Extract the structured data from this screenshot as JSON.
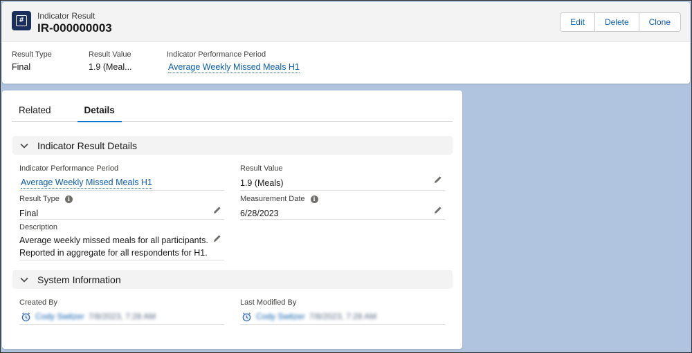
{
  "header": {
    "object_label": "Indicator Result",
    "record_name": "IR-000000003",
    "icon": "indicator-result-icon",
    "actions": [
      "Edit",
      "Delete",
      "Clone"
    ]
  },
  "highlights": [
    {
      "label": "Result Type",
      "value": "Final"
    },
    {
      "label": "Result Value",
      "value": "1.9 (Meal..."
    },
    {
      "label": "Indicator Performance Period",
      "value": "Average Weekly Missed Meals H1"
    }
  ],
  "tabs": [
    "Related",
    "Details"
  ],
  "active_tab": "Details",
  "sections": {
    "details": {
      "title": "Indicator Result Details",
      "fields": {
        "performance_period": {
          "label": "Indicator Performance Period",
          "value": "Average Weekly Missed Meals H1"
        },
        "result_value": {
          "label": "Result Value",
          "value": "1.9 (Meals)"
        },
        "result_type": {
          "label": "Result Type",
          "value": "Final"
        },
        "measurement_date": {
          "label": "Measurement Date",
          "value": "6/28/2023"
        },
        "description": {
          "label": "Description",
          "line1": "Average weekly missed meals for all participants.",
          "line2": "Reported in aggregate for all respondents for H1."
        }
      }
    },
    "system": {
      "title": "System Information",
      "created_by": {
        "label": "Created By",
        "user": "Cody Switzer",
        "timestamp": "7/8/2023, 7:28 AM"
      },
      "last_modified_by": {
        "label": "Last Modified By",
        "user": "Cody Switzer",
        "timestamp": "7/8/2023, 7:28 AM"
      }
    }
  },
  "colors": {
    "background": "#b0c4df",
    "brand_icon": "#1b2f5c",
    "link": "#0b5cab",
    "tab_active": "#0176d3"
  }
}
